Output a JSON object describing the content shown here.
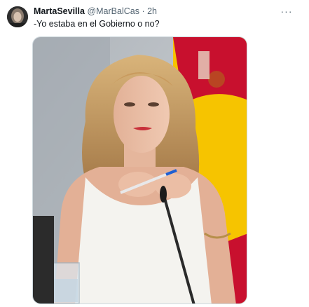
{
  "tweet": {
    "author_name": "MartaSevilla",
    "author_handle": "@MarBalCas",
    "separator": "·",
    "time": "2h",
    "text": "-Yo estaba en el Gobierno o no?",
    "more_icon": "more-horizontal-icon"
  },
  "media": {
    "kind": "photo",
    "accent_colors": {
      "flag_red": "#c8102e",
      "flag_yellow": "#f6c400",
      "background_wall": "#c9cdd2",
      "dress": "#f4f3ef",
      "hair": "#b98b52"
    }
  }
}
